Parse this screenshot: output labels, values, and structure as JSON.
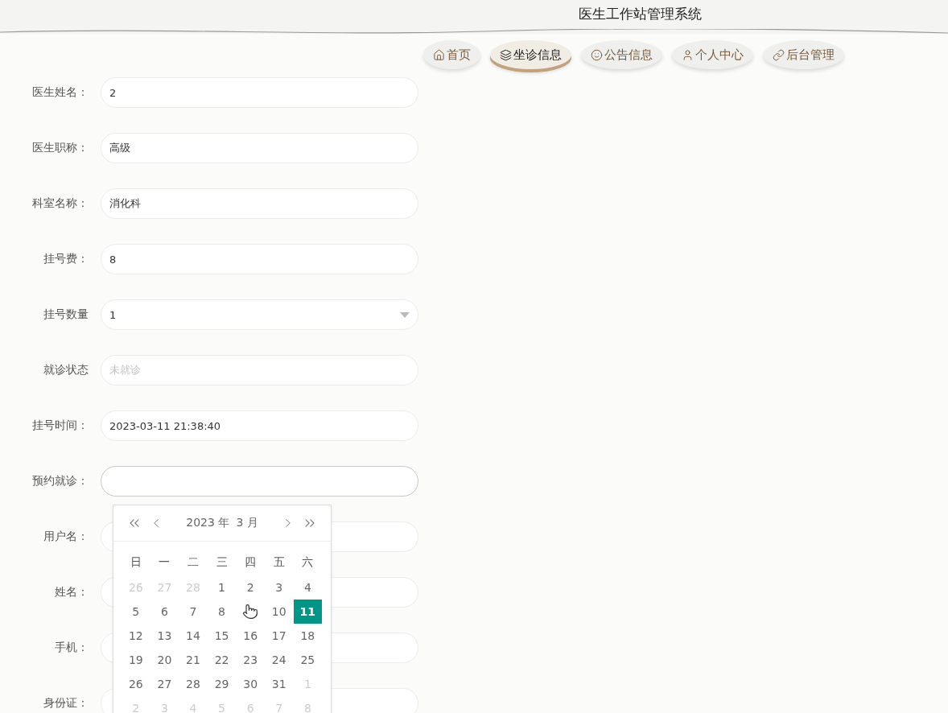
{
  "header": {
    "title": "医生工作站管理系统"
  },
  "nav": [
    {
      "label": "首页",
      "selected": false
    },
    {
      "label": "坐诊信息",
      "selected": true
    },
    {
      "label": "公告信息",
      "selected": false
    },
    {
      "label": "个人中心",
      "selected": false
    },
    {
      "label": "后台管理",
      "selected": false
    }
  ],
  "form": [
    {
      "label": "医生姓名：",
      "kind": "text",
      "value": "2"
    },
    {
      "label": "医生职称：",
      "kind": "text",
      "value": "高级"
    },
    {
      "label": "科室名称：",
      "kind": "text",
      "value": "消化科"
    },
    {
      "label": "挂号费：",
      "kind": "text",
      "value": "8"
    },
    {
      "label": "挂号数量",
      "kind": "select",
      "value": "1"
    },
    {
      "label": "就诊状态",
      "kind": "text",
      "placeholder": "未就诊"
    },
    {
      "label": "挂号时间：",
      "kind": "text",
      "value": "2023-03-11 21:38:40"
    },
    {
      "label": "预约就诊：",
      "kind": "text",
      "focused": true
    },
    {
      "label": "用户名：",
      "kind": "text"
    },
    {
      "label": "姓名：",
      "kind": "text"
    },
    {
      "label": "手机：",
      "kind": "text"
    },
    {
      "label": "身份证：",
      "kind": "text"
    }
  ],
  "datepicker": {
    "year": "2023 年",
    "month": "3 月",
    "weekdays": [
      "日",
      "一",
      "二",
      "三",
      "四",
      "五",
      "六"
    ],
    "days": [
      {
        "label": "26",
        "muted": true,
        "selected": false
      },
      {
        "label": "27",
        "muted": true,
        "selected": false
      },
      {
        "label": "28",
        "muted": true,
        "selected": false
      },
      {
        "label": "1",
        "muted": false,
        "selected": false
      },
      {
        "label": "2",
        "muted": false,
        "selected": false
      },
      {
        "label": "3",
        "muted": false,
        "selected": false
      },
      {
        "label": "4",
        "muted": false,
        "selected": false
      },
      {
        "label": "5",
        "muted": false,
        "selected": false
      },
      {
        "label": "6",
        "muted": false,
        "selected": false
      },
      {
        "label": "7",
        "muted": false,
        "selected": false
      },
      {
        "label": "8",
        "muted": false,
        "selected": false
      },
      {
        "pointer": true,
        "muted": false,
        "selected": false
      },
      {
        "label": "10",
        "muted": false,
        "selected": false
      },
      {
        "label": "11",
        "muted": false,
        "selected": true
      },
      {
        "label": "12",
        "muted": false,
        "selected": false
      },
      {
        "label": "13",
        "muted": false,
        "selected": false
      },
      {
        "label": "14",
        "muted": false,
        "selected": false
      },
      {
        "label": "15",
        "muted": false,
        "selected": false
      },
      {
        "label": "16",
        "muted": false,
        "selected": false
      },
      {
        "label": "17",
        "muted": false,
        "selected": false
      },
      {
        "label": "18",
        "muted": false,
        "selected": false
      },
      {
        "label": "19",
        "muted": false,
        "selected": false
      },
      {
        "label": "20",
        "muted": false,
        "selected": false
      },
      {
        "label": "21",
        "muted": false,
        "selected": false
      },
      {
        "label": "22",
        "muted": false,
        "selected": false
      },
      {
        "label": "23",
        "muted": false,
        "selected": false
      },
      {
        "label": "24",
        "muted": false,
        "selected": false
      },
      {
        "label": "25",
        "muted": false,
        "selected": false
      },
      {
        "label": "26",
        "muted": false,
        "selected": false
      },
      {
        "label": "27",
        "muted": false,
        "selected": false
      },
      {
        "label": "28",
        "muted": false,
        "selected": false
      },
      {
        "label": "29",
        "muted": false,
        "selected": false
      },
      {
        "label": "30",
        "muted": false,
        "selected": false
      },
      {
        "label": "31",
        "muted": false,
        "selected": false
      },
      {
        "label": "1",
        "muted": true,
        "selected": false
      },
      {
        "label": "2",
        "muted": true,
        "selected": false
      },
      {
        "label": "3",
        "muted": true,
        "selected": false
      },
      {
        "label": "4",
        "muted": true,
        "selected": false
      },
      {
        "label": "5",
        "muted": true,
        "selected": false
      },
      {
        "label": "6",
        "muted": true,
        "selected": false
      },
      {
        "label": "7",
        "muted": true,
        "selected": false
      },
      {
        "label": "8",
        "muted": true,
        "selected": false
      }
    ]
  }
}
